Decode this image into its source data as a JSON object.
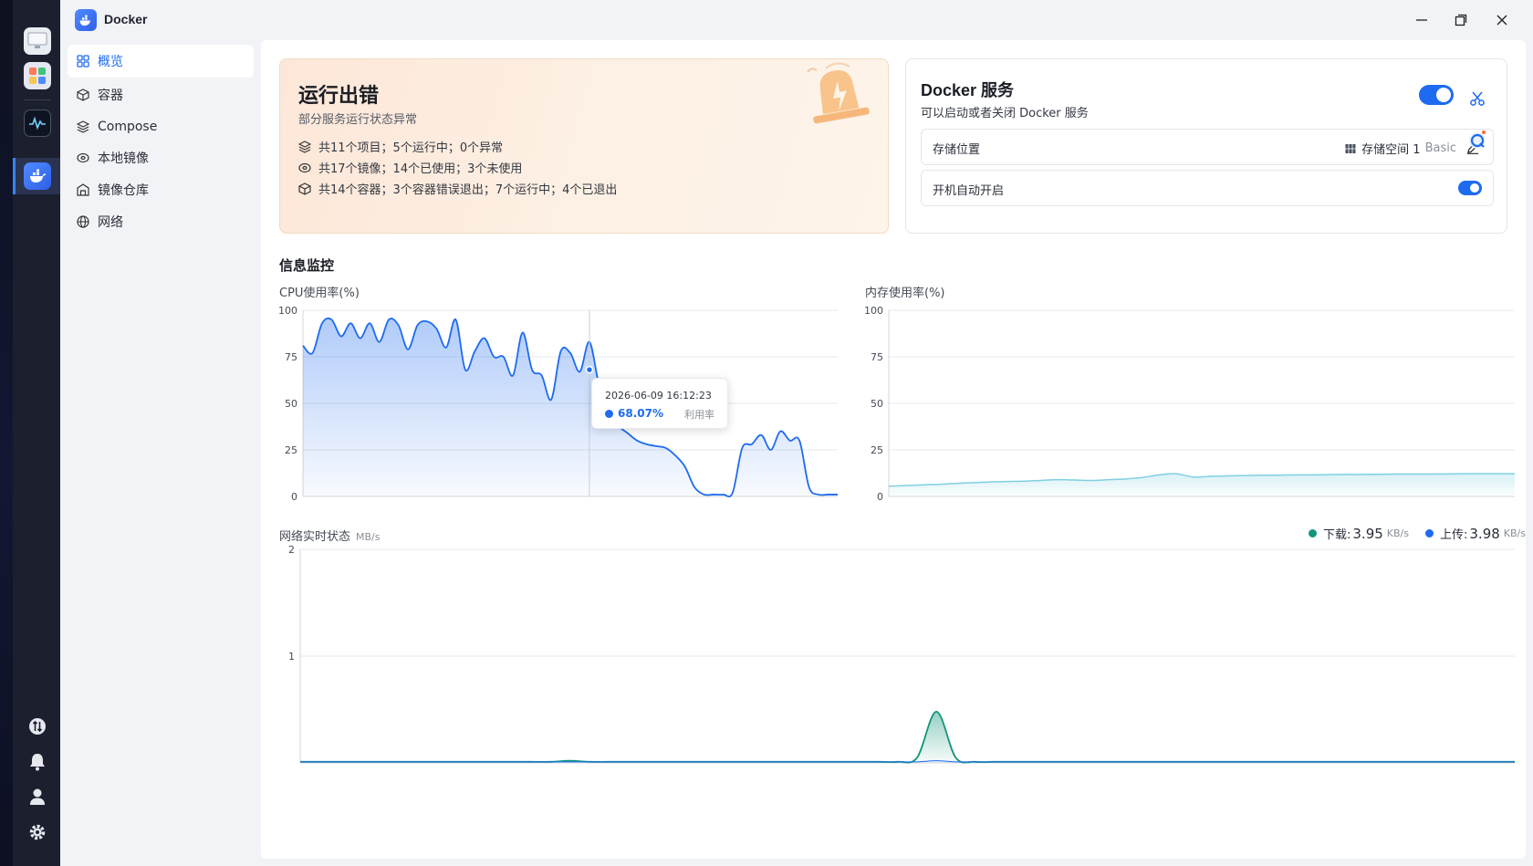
{
  "app": {
    "title": "Docker"
  },
  "sidebar": {
    "items": [
      {
        "label": "概览",
        "icon": "grid-icon",
        "active": true
      },
      {
        "label": "容器",
        "icon": "box-icon"
      },
      {
        "label": "Compose",
        "icon": "layers-icon"
      },
      {
        "label": "本地镜像",
        "icon": "disc-icon"
      },
      {
        "label": "镜像仓库",
        "icon": "warehouse-icon"
      },
      {
        "label": "网络",
        "icon": "globe-icon"
      }
    ]
  },
  "status_card": {
    "title": "运行出错",
    "subtitle": "部分服务运行状态异常",
    "lines": [
      "共11个项目；5个运行中；0个异常",
      "共17个镜像；14个已使用；3个未使用",
      "共14个容器；3个容器错误退出；7个运行中；4个已退出"
    ]
  },
  "service_card": {
    "title": "Docker 服务",
    "description": "可以启动或者关闭 Docker 服务",
    "enabled": true,
    "storage_label": "存储位置",
    "storage_value": "存储空间 1",
    "storage_tag": "Basic",
    "autostart_label": "开机自动开启",
    "autostart_enabled": true
  },
  "monitor": {
    "section_title": "信息监控",
    "cpu_label": "CPU使用率(%)",
    "mem_label": "内存使用率(%)",
    "net_label": "网络实时状态",
    "net_unit": "MB/s",
    "download_label": "下载:",
    "download_value": "3.95",
    "download_unit": "KB/s",
    "upload_label": "上传:",
    "upload_value": "3.98",
    "upload_unit": "KB/s",
    "tooltip_time": "2026-06-09 16:12:23",
    "tooltip_value": "68.07%",
    "tooltip_name": "利用率"
  },
  "colors": {
    "accent": "#1e6bf0",
    "cpu_line": "#1e6bf0",
    "mem_line": "#7fd0e2",
    "download": "#14967a",
    "upload": "#1e6bf0"
  },
  "chart_data": [
    {
      "type": "area",
      "title": "CPU使用率(%)",
      "ylim": [
        0,
        100
      ],
      "yticks": [
        0,
        25,
        50,
        75,
        100
      ],
      "values": [
        81,
        77,
        93,
        95,
        86,
        93,
        85,
        93,
        83,
        95,
        92,
        79,
        92,
        94,
        90,
        80,
        95,
        68,
        78,
        85,
        75,
        75,
        65,
        88,
        68,
        65,
        52,
        78,
        77,
        67,
        83,
        60,
        45,
        38,
        34,
        30,
        28,
        27,
        26,
        22,
        16,
        5,
        1,
        1,
        1,
        2,
        26,
        28,
        33,
        25,
        35,
        30,
        30,
        5,
        1,
        1,
        1
      ],
      "highlight": {
        "index": 30,
        "value": 68.07
      }
    },
    {
      "type": "area",
      "title": "内存使用率(%)",
      "ylim": [
        0,
        100
      ],
      "yticks": [
        0,
        25,
        50,
        75,
        100
      ],
      "values": [
        5.5,
        5.8,
        6.2,
        6.5,
        7,
        7.4,
        7.8,
        8,
        8.2,
        8.6,
        9,
        8.8,
        8.6,
        9,
        9.4,
        10.2,
        11.6,
        12.2,
        10.4,
        10.8,
        11,
        11.2,
        11.4,
        11.4,
        11.6,
        11.6,
        11.7,
        11.8,
        11.8,
        11.9,
        12,
        12,
        12,
        12.1,
        12.2,
        12.2,
        12.2,
        12.2
      ]
    },
    {
      "type": "area",
      "title": "网络实时状态",
      "ylim": [
        0,
        2
      ],
      "yticks": [
        1,
        2
      ],
      "series": [
        {
          "name": "下载",
          "values": [
            0.01,
            0.01,
            0.01,
            0.01,
            0.01,
            0.01,
            0.01,
            0.01,
            0.01,
            0.01,
            0.01,
            0.01,
            0.01,
            0.01,
            0.02,
            0.01,
            0.01,
            0.01,
            0.01,
            0.01,
            0.01,
            0.01,
            0.01,
            0.01,
            0.01,
            0.01,
            0.01,
            0.01,
            0.01,
            0.01,
            0.01,
            0.01,
            0.05,
            0.48,
            0.05,
            0.01,
            0.01,
            0.01,
            0.01,
            0.01,
            0.01,
            0.01,
            0.01,
            0.01,
            0.01,
            0.01,
            0.01,
            0.01,
            0.01,
            0.01,
            0.01,
            0.01,
            0.01,
            0.01,
            0.01,
            0.01,
            0.01,
            0.01,
            0.01,
            0.01,
            0.01,
            0.01,
            0.01,
            0.01
          ]
        },
        {
          "name": "上传",
          "values": [
            0.01,
            0.01,
            0.01,
            0.01,
            0.01,
            0.01,
            0.01,
            0.01,
            0.01,
            0.01,
            0.01,
            0.01,
            0.01,
            0.01,
            0.01,
            0.01,
            0.01,
            0.01,
            0.01,
            0.01,
            0.01,
            0.01,
            0.01,
            0.01,
            0.01,
            0.01,
            0.01,
            0.01,
            0.01,
            0.01,
            0.01,
            0.01,
            0.01,
            0.02,
            0.01,
            0.01,
            0.01,
            0.01,
            0.01,
            0.01,
            0.01,
            0.01,
            0.01,
            0.01,
            0.01,
            0.01,
            0.01,
            0.01,
            0.01,
            0.01,
            0.01,
            0.01,
            0.01,
            0.01,
            0.01,
            0.01,
            0.01,
            0.01,
            0.01,
            0.01,
            0.01,
            0.01,
            0.01,
            0.01
          ]
        }
      ]
    }
  ]
}
